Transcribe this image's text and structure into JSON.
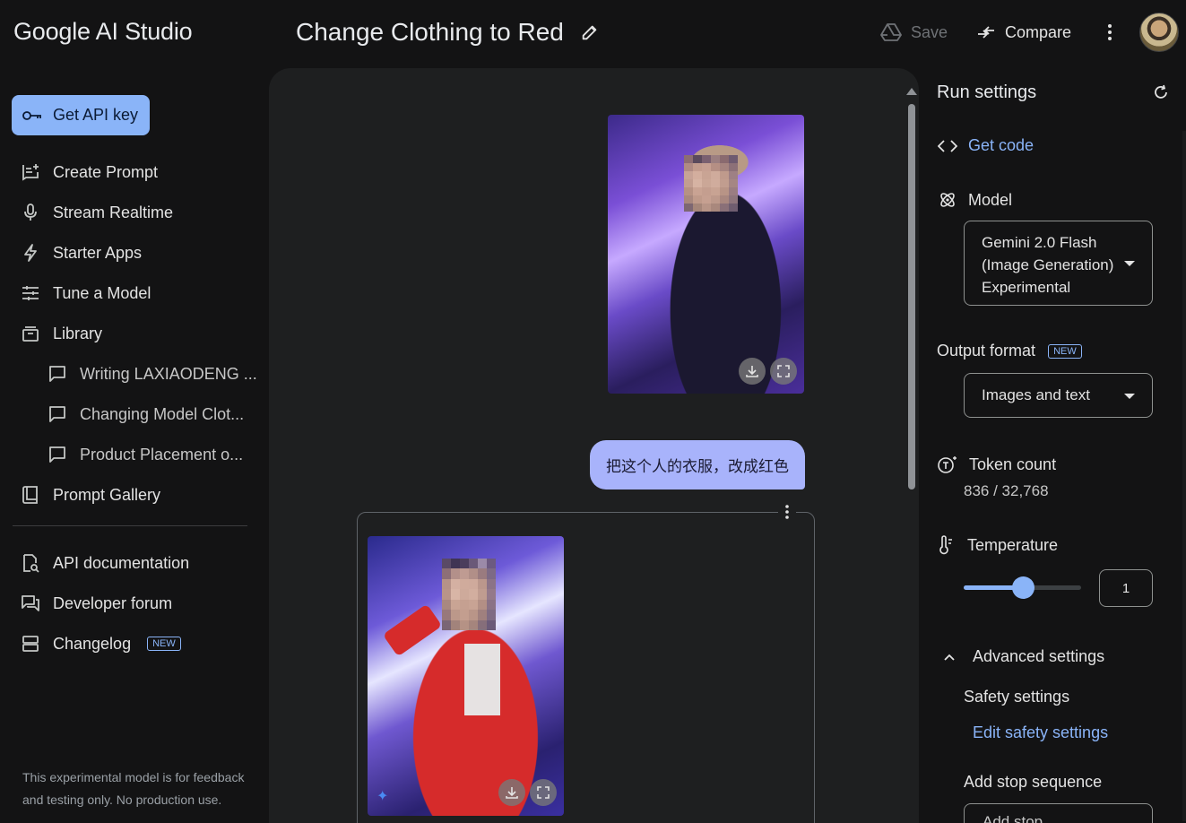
{
  "app": {
    "brand": "Google AI Studio"
  },
  "header": {
    "prompt_title": "Change Clothing to Red",
    "save_label": "Save",
    "compare_label": "Compare"
  },
  "sidebar": {
    "api_key_label": "Get API key",
    "items": [
      {
        "label": "Create Prompt",
        "icon": "create-prompt-icon"
      },
      {
        "label": "Stream Realtime",
        "icon": "mic-icon"
      },
      {
        "label": "Starter Apps",
        "icon": "bolt-icon"
      },
      {
        "label": "Tune a Model",
        "icon": "tune-icon"
      },
      {
        "label": "Library",
        "icon": "library-icon"
      }
    ],
    "library_items": [
      "Writing LAXIAODENG ...",
      "Changing Model Clot...",
      "Product Placement o..."
    ],
    "prompt_gallery_label": "Prompt Gallery",
    "resources": [
      {
        "label": "API documentation",
        "icon": "api-doc-icon"
      },
      {
        "label": "Developer forum",
        "icon": "forum-icon"
      },
      {
        "label": "Changelog",
        "icon": "changelog-icon",
        "badge": "NEW"
      }
    ],
    "footer_note": "This experimental model is for feedback and testing only. No production use."
  },
  "chat": {
    "user_message": "把这个人的衣服，改成红色"
  },
  "run_settings": {
    "title": "Run settings",
    "get_code_label": "Get code",
    "model_label": "Model",
    "model_value": "Gemini 2.0 Flash (Image Generation) Experimental",
    "output_format_label": "Output format",
    "output_format_badge": "NEW",
    "output_format_value": "Images and text",
    "token_count_label": "Token count",
    "token_count_value": "836 / 32,768",
    "temperature_label": "Temperature",
    "temperature_value": "1",
    "temperature_fraction": 0.5,
    "advanced_label": "Advanced settings",
    "safety_label": "Safety settings",
    "edit_safety_label": "Edit safety settings",
    "stop_sequence_label": "Add stop sequence",
    "stop_sequence_placeholder": "Add stop..."
  },
  "colors": {
    "accent": "#8ab4f8",
    "user_bubble": "#a8b3fb",
    "background": "#131314",
    "panel": "#1e1f20"
  }
}
